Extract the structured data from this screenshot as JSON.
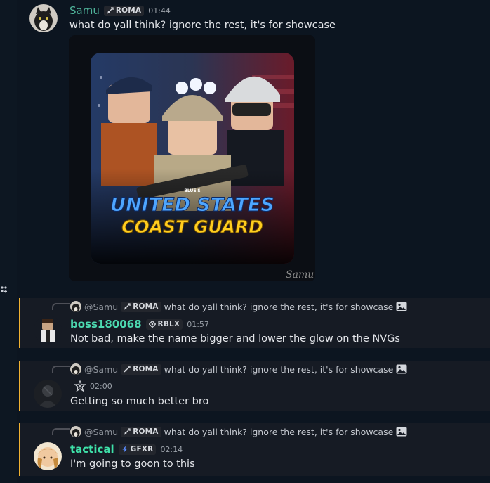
{
  "messages": [
    {
      "author": "Samu",
      "author_color": "#4fb39a",
      "badge": "ROMA",
      "time": "01:44",
      "text": "what do yall think? ignore the rest, it's for showcase",
      "image": {
        "line1": "UNITED STATES",
        "line2": "COAST GUARD",
        "small": "BLUE'S",
        "signature": "Samu"
      }
    },
    {
      "reply": {
        "author": "@Samu",
        "badge": "ROMA",
        "text": "what do yall think? ignore the rest, it's for showcase"
      },
      "author": "boss180068",
      "author_color": "#4cd9b0",
      "badge": "RBLX",
      "time": "01:57",
      "text": "Not bad, make the name bigger and lower the glow on the NVGs"
    },
    {
      "reply": {
        "author": "@Samu",
        "badge": "ROMA",
        "text": "what do yall think? ignore the rest, it's for showcase"
      },
      "author": "",
      "badge": "",
      "time": "02:00",
      "text": "Getting so much better bro"
    },
    {
      "reply": {
        "author": "@Samu",
        "badge": "ROMA",
        "text": "what do yall think? ignore the rest, it's for showcase"
      },
      "author": "tactical",
      "author_color": "#3ee0a8",
      "badge": "GFXR",
      "time": "02:14",
      "text": "I'm going to goon to this"
    }
  ],
  "icons": [
    "app-directory-icon",
    "sword-badge-icon",
    "diamond-badge-icon",
    "bolt-badge-icon",
    "image-attachment-icon",
    "star-badge-icon"
  ]
}
